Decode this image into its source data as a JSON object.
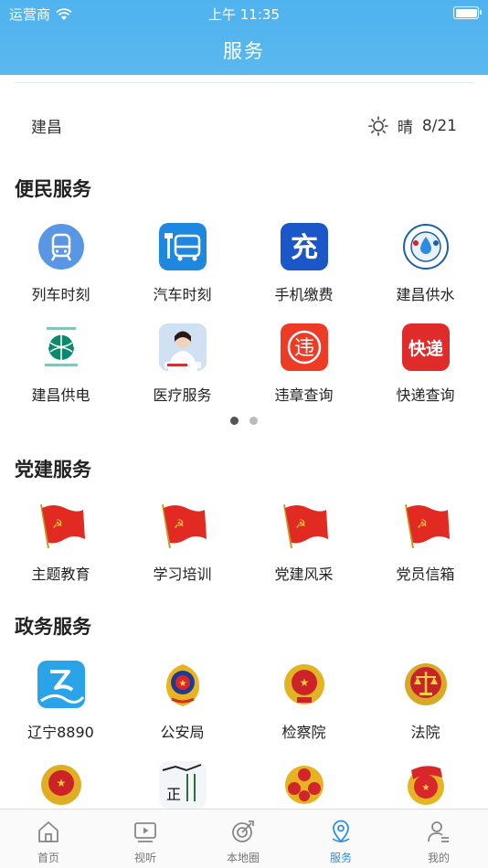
{
  "status_bar": {
    "carrier": "运营商",
    "time": "上午 11:35"
  },
  "header": {
    "title": "服务"
  },
  "location": {
    "city": "建昌",
    "weather_text": "晴",
    "date": "8/21",
    "weather_icon": "sun-icon"
  },
  "sections": {
    "bianmin": {
      "title": "便民服务",
      "items": [
        {
          "label": "列车时刻",
          "icon": "train-icon"
        },
        {
          "label": "汽车时刻",
          "icon": "bus-icon"
        },
        {
          "label": "手机缴费",
          "icon": "phone-recharge-icon"
        },
        {
          "label": "建昌供水",
          "icon": "water-supply-icon"
        },
        {
          "label": "建昌供电",
          "icon": "power-grid-icon"
        },
        {
          "label": "医疗服务",
          "icon": "medical-service-icon"
        },
        {
          "label": "违章查询",
          "icon": "violation-icon"
        },
        {
          "label": "快递查询",
          "icon": "express-icon"
        }
      ],
      "pager": {
        "pages": 2,
        "current": 1
      }
    },
    "dangjian": {
      "title": "党建服务",
      "items": [
        {
          "label": "主题教育",
          "icon": "party-flag-icon"
        },
        {
          "label": "学习培训",
          "icon": "party-flag-icon"
        },
        {
          "label": "党建风采",
          "icon": "party-flag-icon"
        },
        {
          "label": "党员信箱",
          "icon": "party-flag-icon"
        }
      ]
    },
    "zhengwu": {
      "title": "政务服务",
      "items": [
        {
          "label": "辽宁8890",
          "icon": "liaoning-8890-icon"
        },
        {
          "label": "公安局",
          "icon": "police-emblem-icon"
        },
        {
          "label": "检察院",
          "icon": "procuratorate-emblem-icon"
        },
        {
          "label": "法院",
          "icon": "court-emblem-icon"
        },
        {
          "label": "",
          "icon": "national-emblem-icon"
        },
        {
          "label": "",
          "icon": "calligraphy-icon"
        },
        {
          "label": "",
          "icon": "womens-federation-icon"
        },
        {
          "label": "",
          "icon": "youth-league-icon"
        }
      ]
    }
  },
  "tabbar": {
    "items": [
      {
        "label": "首页",
        "icon": "home-icon"
      },
      {
        "label": "视听",
        "icon": "video-icon"
      },
      {
        "label": "本地圈",
        "icon": "local-circle-icon"
      },
      {
        "label": "服务",
        "icon": "location-pin-icon",
        "active": true
      },
      {
        "label": "我的",
        "icon": "profile-icon"
      }
    ]
  },
  "colors": {
    "header": "#4fb3ee",
    "accent": "#2d8fe2",
    "party_red": "#e02a22"
  }
}
